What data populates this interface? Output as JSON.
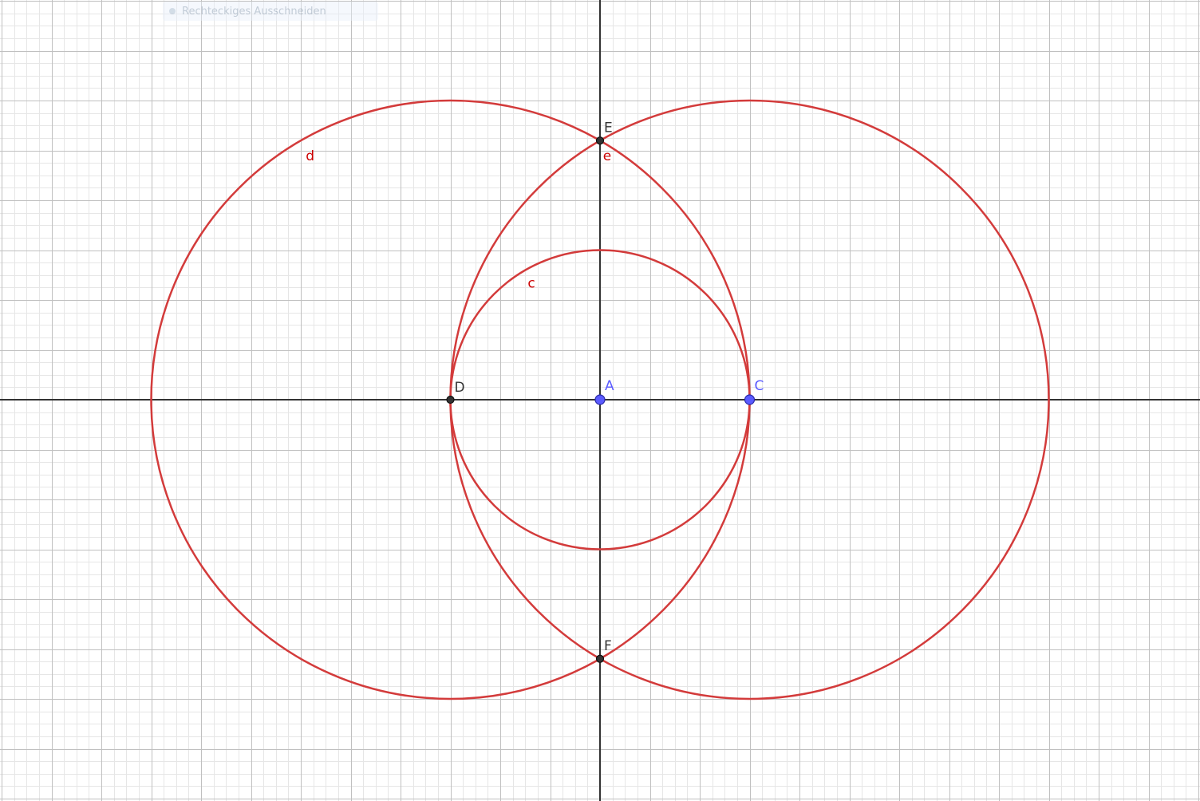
{
  "tool_hint": {
    "icon": "rectangle-select-icon",
    "label": "Rechteckiges Ausschneiden"
  },
  "colors": {
    "background": "#ffffff",
    "minor_grid": "#e6e6e6",
    "major_grid": "#c0c0c0",
    "axes": "#333333",
    "curve": "#d33b3b",
    "free_point": "#5b5bff",
    "dependent_point": "#333333",
    "curve_label": "#cc0000"
  },
  "view": {
    "grid_minor_step": 0.25,
    "grid_major_step": 1,
    "x_range": [
      -12.05,
      12.0
    ],
    "y_range": [
      -8.0,
      8.0
    ]
  },
  "points": [
    {
      "name": "A",
      "x": 0,
      "y": 0,
      "kind": "free"
    },
    {
      "name": "C",
      "x": 3,
      "y": 0,
      "kind": "free"
    },
    {
      "name": "D",
      "x": -3,
      "y": 0,
      "kind": "dependent"
    },
    {
      "name": "E",
      "x": 0,
      "y": 5.196,
      "kind": "dependent"
    },
    {
      "name": "F",
      "x": 0,
      "y": -5.196,
      "kind": "dependent"
    }
  ],
  "circles": [
    {
      "name": "c",
      "cx": 0,
      "cy": 0,
      "r": 3
    },
    {
      "name": "d",
      "cx": -3,
      "cy": 0,
      "r": 6
    },
    {
      "name": "e",
      "cx": 3,
      "cy": 0,
      "r": 6
    }
  ]
}
